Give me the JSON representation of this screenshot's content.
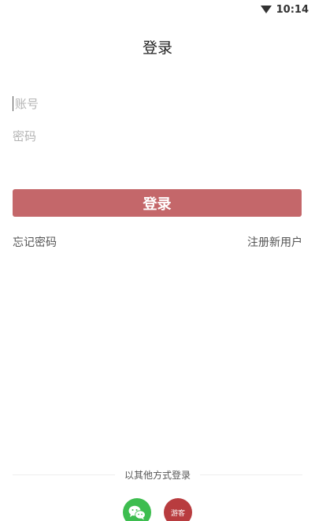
{
  "status_bar": {
    "time": "10:14",
    "icon": "wifi-icon"
  },
  "header": {
    "title": "登录"
  },
  "form": {
    "account_placeholder": "账号",
    "password_placeholder": "密码",
    "login_label": "登录"
  },
  "links": {
    "forgot_password": "忘记密码",
    "register": "注册新用户"
  },
  "other_login": {
    "label": "以其他方式登录",
    "wechat_icon": "wechat-icon",
    "guest_label": "游客"
  },
  "colors": {
    "accent": "#c4676a",
    "wechat": "#3dbd4f",
    "guest": "#b83c3f"
  }
}
